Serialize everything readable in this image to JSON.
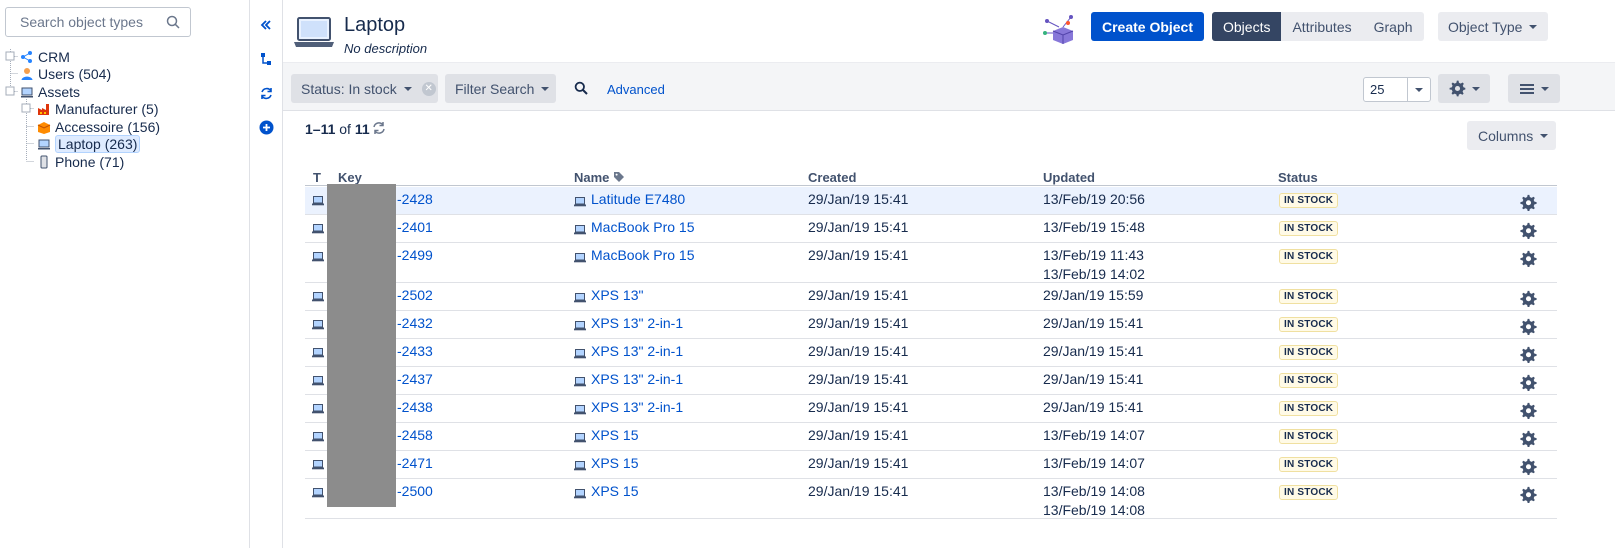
{
  "sidebar": {
    "search_placeholder": "Search object types",
    "tree": [
      {
        "label": "CRM",
        "icon": "crm-icon",
        "level": 1
      },
      {
        "label": "Users (504)",
        "icon": "user-icon",
        "level": 1
      },
      {
        "label": "Assets",
        "icon": "computer-icon",
        "level": 1
      },
      {
        "label": "Manufacturer (5)",
        "icon": "factory-icon",
        "level": 2
      },
      {
        "label": "Accessoire (156)",
        "icon": "box-icon",
        "level": 2
      },
      {
        "label": "Laptop (263)",
        "icon": "laptop-icon",
        "level": 2,
        "selected": true
      },
      {
        "label": "Phone (71)",
        "icon": "phone-icon",
        "level": 2
      }
    ]
  },
  "header": {
    "title": "Laptop",
    "description": "No description",
    "create_label": "Create Object",
    "views": [
      "Objects",
      "Attributes",
      "Graph"
    ],
    "active_view": "Objects",
    "object_type_label": "Object Type"
  },
  "filters": {
    "status_chip": "Status: In stock",
    "filter_search": "Filter Search",
    "advanced": "Advanced",
    "page_size": "25"
  },
  "results": {
    "range": "1–11",
    "of_word": "of",
    "total": "11",
    "columns_label": "Columns"
  },
  "table": {
    "headers": {
      "t": "T",
      "key": "Key",
      "name": "Name",
      "created": "Created",
      "updated": "Updated",
      "status": "Status"
    },
    "rows": [
      {
        "key": "-2428",
        "name": "Latitude E7480",
        "created": "29/Jan/19 15:41",
        "updated": "13/Feb/19 20:56",
        "updated2": "",
        "status": "IN STOCK"
      },
      {
        "key": "-2401",
        "name": "MacBook Pro 15",
        "created": "29/Jan/19 15:41",
        "updated": "13/Feb/19 15:48",
        "updated2": "",
        "status": "IN STOCK"
      },
      {
        "key": "-2499",
        "name": "MacBook Pro 15",
        "created": "29/Jan/19 15:41",
        "updated": "13/Feb/19 11:43",
        "updated2": "13/Feb/19 14:02",
        "status": "IN STOCK"
      },
      {
        "key": "-2502",
        "name": "XPS 13\"",
        "created": "29/Jan/19 15:41",
        "updated": "29/Jan/19 15:59",
        "updated2": "",
        "status": "IN STOCK"
      },
      {
        "key": "-2432",
        "name": "XPS 13\" 2-in-1",
        "created": "29/Jan/19 15:41",
        "updated": "29/Jan/19 15:41",
        "updated2": "",
        "status": "IN STOCK"
      },
      {
        "key": "-2433",
        "name": "XPS 13\" 2-in-1",
        "created": "29/Jan/19 15:41",
        "updated": "29/Jan/19 15:41",
        "updated2": "",
        "status": "IN STOCK"
      },
      {
        "key": "-2437",
        "name": "XPS 13\" 2-in-1",
        "created": "29/Jan/19 15:41",
        "updated": "29/Jan/19 15:41",
        "updated2": "",
        "status": "IN STOCK"
      },
      {
        "key": "-2438",
        "name": "XPS 13\" 2-in-1",
        "created": "29/Jan/19 15:41",
        "updated": "29/Jan/19 15:41",
        "updated2": "",
        "status": "IN STOCK"
      },
      {
        "key": "-2458",
        "name": "XPS 15",
        "created": "29/Jan/19 15:41",
        "updated": "13/Feb/19 14:07",
        "updated2": "",
        "status": "IN STOCK"
      },
      {
        "key": "-2471",
        "name": "XPS 15",
        "created": "29/Jan/19 15:41",
        "updated": "13/Feb/19 14:07",
        "updated2": "",
        "status": "IN STOCK"
      },
      {
        "key": "-2500",
        "name": "XPS 15",
        "created": "29/Jan/19 15:41",
        "updated": "13/Feb/19 14:08",
        "updated2": "13/Feb/19 14:08",
        "status": "IN STOCK"
      }
    ]
  },
  "colors": {
    "accent": "#0052cc",
    "active_segment": "#344563",
    "redaction": "#8c8c8c",
    "lozenge_bg": "#fffae6"
  }
}
